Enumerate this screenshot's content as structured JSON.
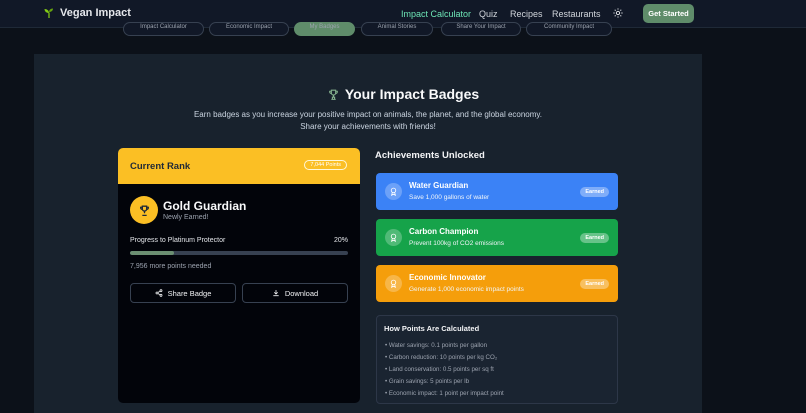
{
  "header": {
    "brand": "Vegan Impact",
    "nav": [
      "Impact Calculator",
      "Quiz",
      "Recipes",
      "Restaurants"
    ],
    "cta": "Get Started"
  },
  "tabs": [
    "Impact Calculator",
    "Economic Impact",
    "My Badges",
    "Animal Stories",
    "Share Your Impact",
    "Community Impact"
  ],
  "section": {
    "title": "Your Impact Badges",
    "intro": "Earn badges as you increase your positive impact on animals, the planet, and the global economy. Share your achievements with friends!"
  },
  "rank": {
    "header": "Current Rank",
    "points": "7,044 Points",
    "name": "Gold Guardian",
    "status": "Newly Earned!",
    "progress_label": "Progress to Platinum Protector",
    "progress_text": "20%",
    "progress_value": 20,
    "remaining": "7,956 more points needed",
    "share_label": "Share Badge",
    "download_label": "Download"
  },
  "achievements": {
    "title": "Achievements Unlocked",
    "items": [
      {
        "name": "Water Guardian",
        "desc": "Save 1,000 gallons of water",
        "status": "Earned",
        "color": "#3b82f6"
      },
      {
        "name": "Carbon Champion",
        "desc": "Prevent 100kg of CO2 emissions",
        "status": "Earned",
        "color": "#16a34a"
      },
      {
        "name": "Economic Innovator",
        "desc": "Generate 1,000 economic impact points",
        "status": "Earned",
        "color": "#f59e0b"
      }
    ]
  },
  "calc": {
    "title": "How Points Are Calculated",
    "items": [
      "• Water savings: 0.1 points per gallon",
      "• Carbon reduction: 10 points per kg CO₂",
      "• Land conservation: 0.5 points per sq ft",
      "• Grain savings: 5 points per lb",
      "• Economic impact: 1 point per impact point"
    ]
  },
  "colors": {
    "accent": "#5f8c6a",
    "rank_gold": "#fbbf24",
    "nav_active": "#6ee7b7"
  }
}
